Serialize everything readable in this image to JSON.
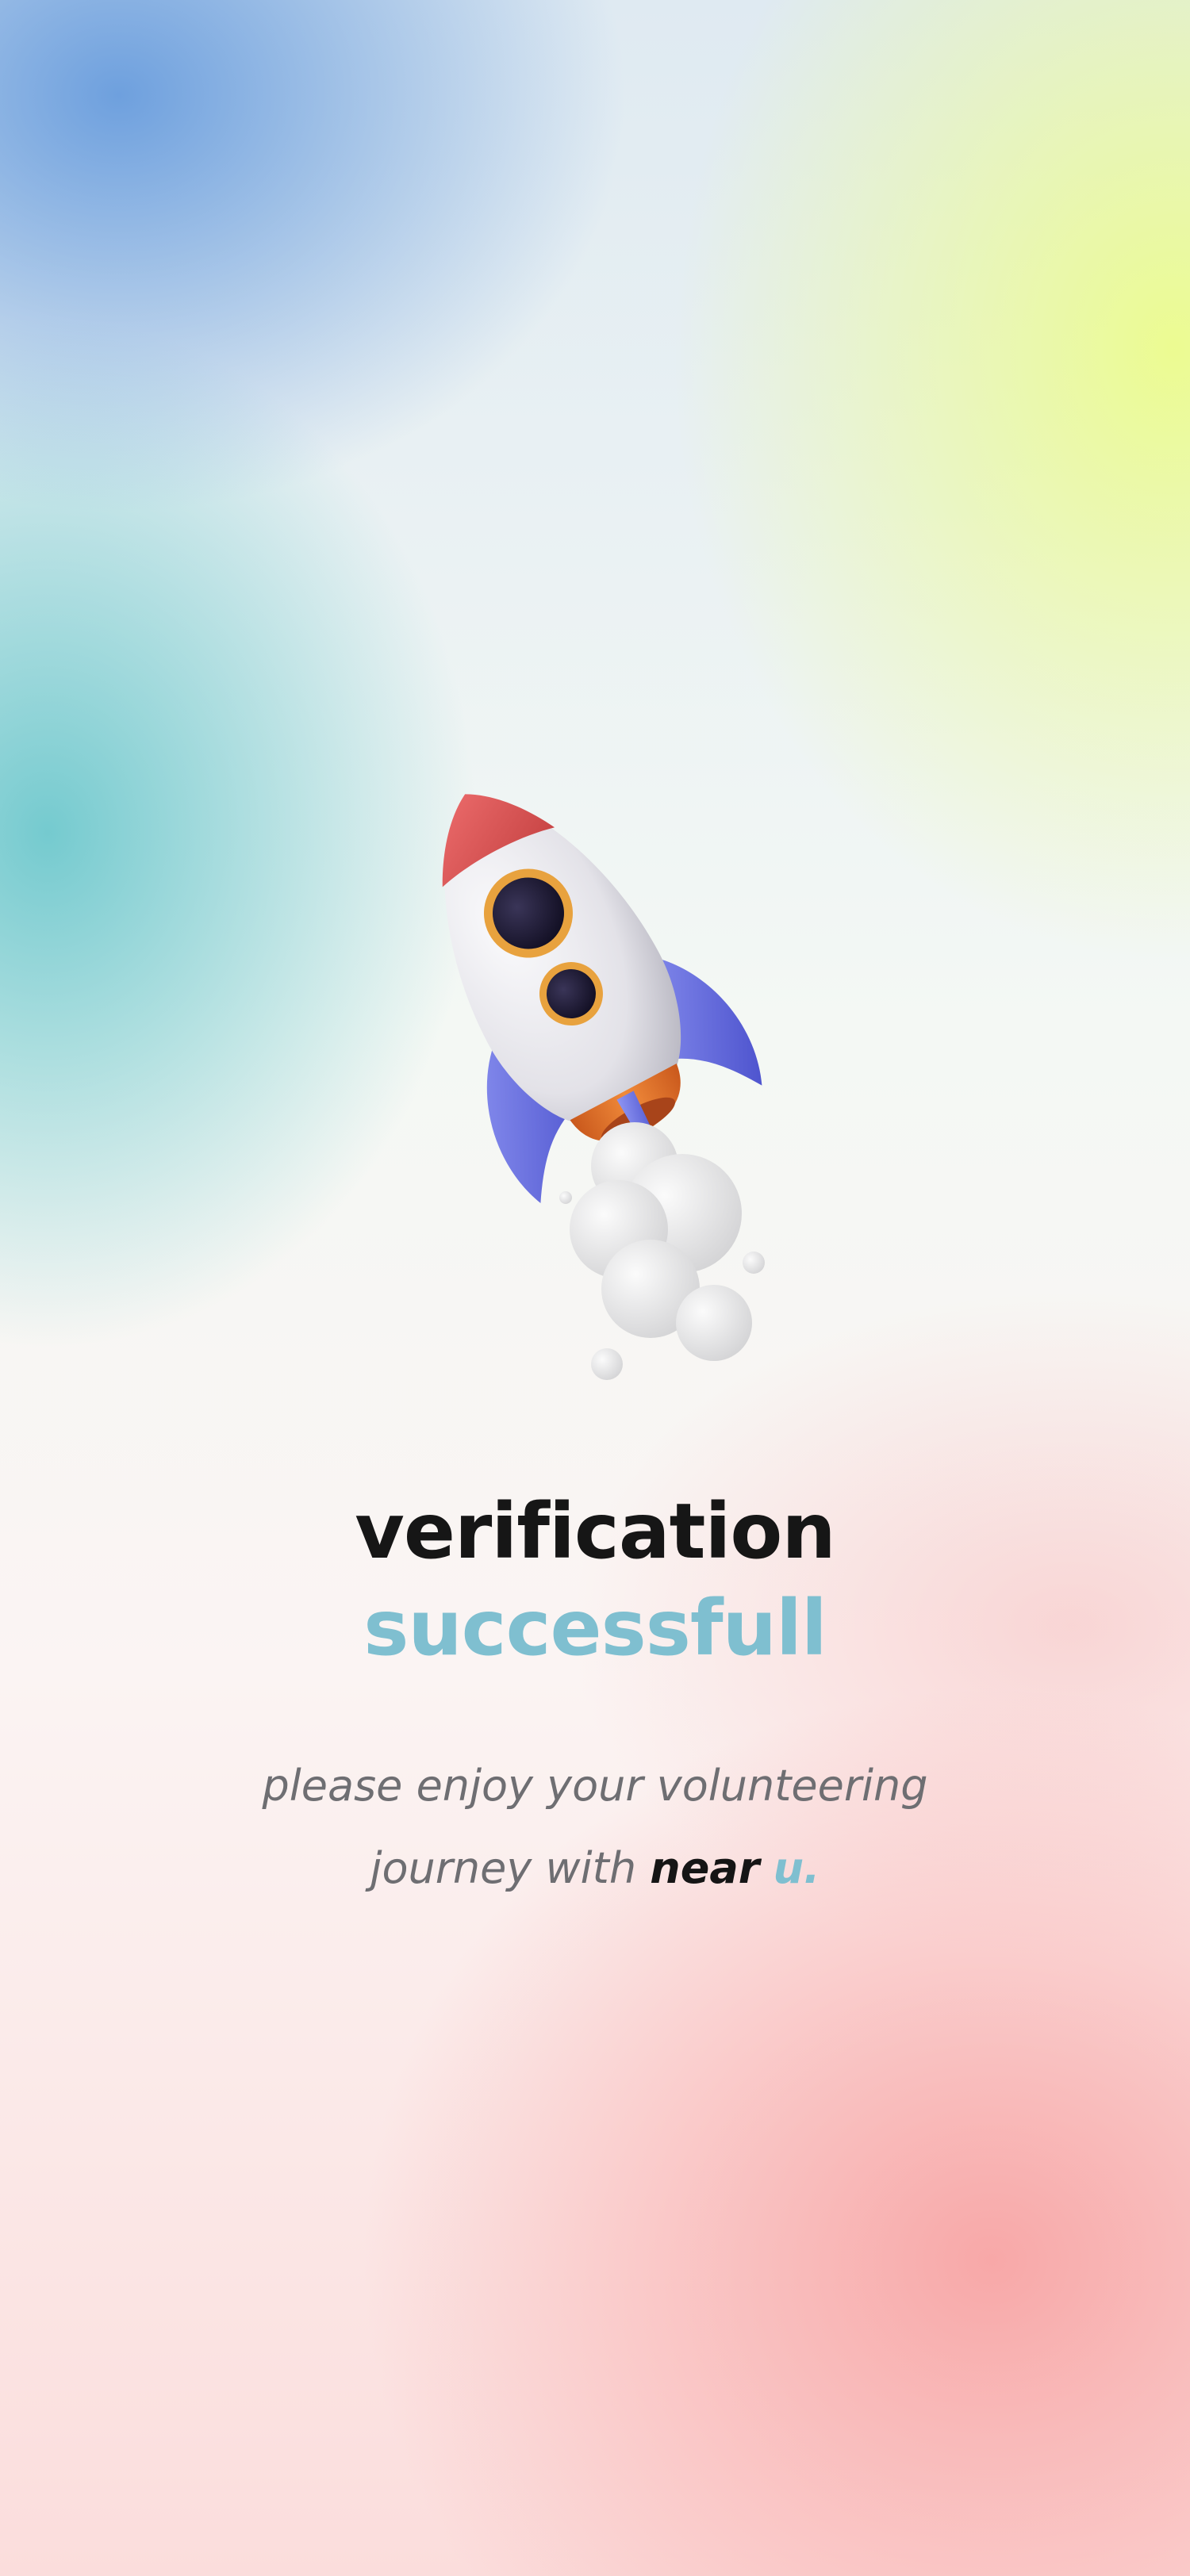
{
  "screen": {
    "title_line1": "verification",
    "title_line2": "successfull",
    "subtitle_line1": "please enjoy your volunteering",
    "subtitle_line2_prefix": "journey with",
    "brand_near": "near",
    "brand_u": "u."
  },
  "illustration": {
    "icon": "rocket-icon"
  },
  "colors": {
    "title_dark": "#161616",
    "title_accent": "#7fbfd0",
    "subtitle": "#6e6e72",
    "rocket_body": "#ecebf0",
    "rocket_nose": "#e35a5a",
    "rocket_fins": "#6a72e6",
    "rocket_window_ring": "#e8a23e",
    "rocket_nozzle": "#e0762e"
  }
}
